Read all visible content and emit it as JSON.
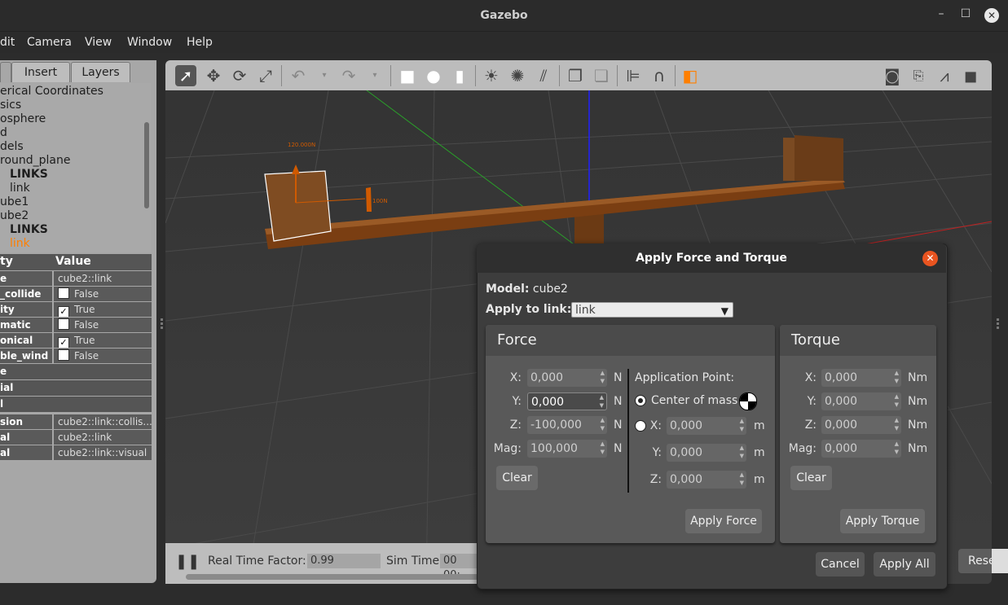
{
  "window": {
    "title": "Gazebo"
  },
  "menubar": {
    "items": [
      "dit",
      "Camera",
      "View",
      "Window",
      "Help"
    ]
  },
  "left_panel": {
    "tabs": [
      "Insert",
      "Layers"
    ],
    "tree": [
      {
        "label": "erical Coordinates",
        "indent": 0
      },
      {
        "label": "sics",
        "indent": 0
      },
      {
        "label": "osphere",
        "indent": 0
      },
      {
        "label": "d",
        "indent": 0
      },
      {
        "label": "dels",
        "indent": 0
      },
      {
        "label": "round_plane",
        "indent": 0
      },
      {
        "label": "LINKS",
        "indent": 1
      },
      {
        "label": "link",
        "indent": 1
      },
      {
        "label": "ube1",
        "indent": 0
      },
      {
        "label": "ube2",
        "indent": 0
      },
      {
        "label": "LINKS",
        "indent": 1
      },
      {
        "label": "link",
        "indent": 1
      }
    ],
    "property_header": {
      "key": "ty",
      "value": "Value"
    },
    "properties": [
      {
        "key": "e",
        "value": "cube2::link",
        "check": null
      },
      {
        "key": "_collide",
        "value": "False",
        "check": false
      },
      {
        "key": "ity",
        "value": "True",
        "check": true
      },
      {
        "key": "matic",
        "value": "False",
        "check": false
      },
      {
        "key": "onical",
        "value": "True",
        "check": true
      },
      {
        "key": "ble_wind",
        "value": "False",
        "check": false
      }
    ],
    "sections": [
      "e",
      "ial",
      "l"
    ],
    "properties2": [
      {
        "key": "sion",
        "value": "cube2::link::collis..."
      },
      {
        "key": "al",
        "value": "cube2::link"
      },
      {
        "key": "al",
        "value": "cube2::link::visual"
      }
    ]
  },
  "viewport": {
    "labels": [
      "120.000N",
      "100N"
    ]
  },
  "bottombar": {
    "rtf_label": "Real Time Factor:",
    "rtf_value": "0.99",
    "sim_label": "Sim Time:",
    "sim_value": "00 00:",
    "reset_label": "Rese"
  },
  "dialog": {
    "title": "Apply Force and Torque",
    "model_label": "Model:",
    "model_value": "cube2",
    "link_label": "Apply to link:",
    "link_value": "link",
    "force": {
      "title": "Force",
      "x_label": "X:",
      "x": "0,000",
      "y_label": "Y:",
      "y": "0,000",
      "z_label": "Z:",
      "z": "-100,000",
      "mag_label": "Mag:",
      "mag": "100,000",
      "unit": "N",
      "clear_label": "Clear",
      "apply_label": "Apply Force"
    },
    "application_point": {
      "title": "Application Point:",
      "com_label": "Center of mass",
      "x_label": "X:",
      "x": "0,000",
      "y_label": "Y:",
      "y": "0,000",
      "z_label": "Z:",
      "z": "0,000",
      "unit": "m"
    },
    "torque": {
      "title": "Torque",
      "x_label": "X:",
      "x": "0,000",
      "y_label": "Y:",
      "y": "0,000",
      "z_label": "Z:",
      "z": "0,000",
      "mag_label": "Mag:",
      "mag": "0,000",
      "unit": "Nm",
      "clear_label": "Clear",
      "apply_label": "Apply Torque"
    },
    "cancel_label": "Cancel",
    "apply_all_label": "Apply All"
  }
}
